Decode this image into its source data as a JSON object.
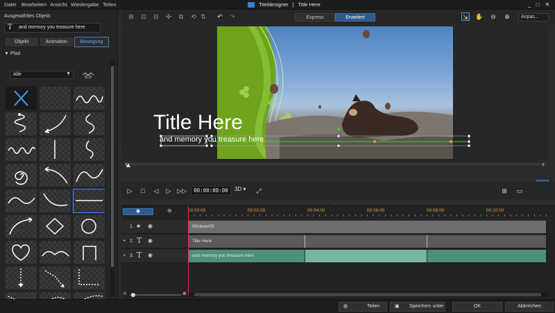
{
  "menu": [
    "Datei",
    "Bearbeiten",
    "Ansicht",
    "Wiedergabe",
    "Teilen"
  ],
  "window": {
    "app_name": "Titeldesigner",
    "separator": "|",
    "doc_name": "Title Here",
    "minimize": "_",
    "maximize": "□",
    "close": "✕"
  },
  "left_panel": {
    "selected_label": "Ausgewähltes Objekt:",
    "selected_value": "and memory you treasure here",
    "tabs": [
      "Objekt",
      "Animation",
      "Bewegung"
    ],
    "active_tab": "Bewegung",
    "section": "Pfad",
    "section_arrow": "▼",
    "filter_value": "Alle",
    "filter_arrow": "▼"
  },
  "toolbar": {
    "express_label": "Express",
    "advanced_label": "Erweitert",
    "fit_label": "Anpas..."
  },
  "preview": {
    "title": "Title Here",
    "subtitle": "and memory you treasure here"
  },
  "transport": {
    "timecode": "00:00:00:00",
    "mode_3d": "3D ▾"
  },
  "timeline": {
    "ticks": [
      "00:00:00",
      "00:02:00",
      "00:04:00",
      "00:06:00",
      "00:08:00",
      "00:10:00"
    ],
    "tracks": [
      {
        "num": "1.",
        "icon": "clover-icon",
        "clip": "00clover03",
        "color": "#6e6e6e"
      },
      {
        "num": "2.",
        "icon": "T",
        "clip": "Title Here",
        "color": "#5a5a5a"
      },
      {
        "num": "3.",
        "icon": "T",
        "clip": "and memory you treasure here",
        "color": "#4e8f80"
      }
    ]
  },
  "footer": {
    "share": "Teilen",
    "save_as": "Speichern unter",
    "ok": "OK",
    "cancel": "Abbrechen"
  },
  "colors": {
    "accent": "#3f8bff",
    "timeline_tick": "#d9a54a",
    "playhead": "#d13a3a",
    "path_line": "#3bd13b"
  }
}
